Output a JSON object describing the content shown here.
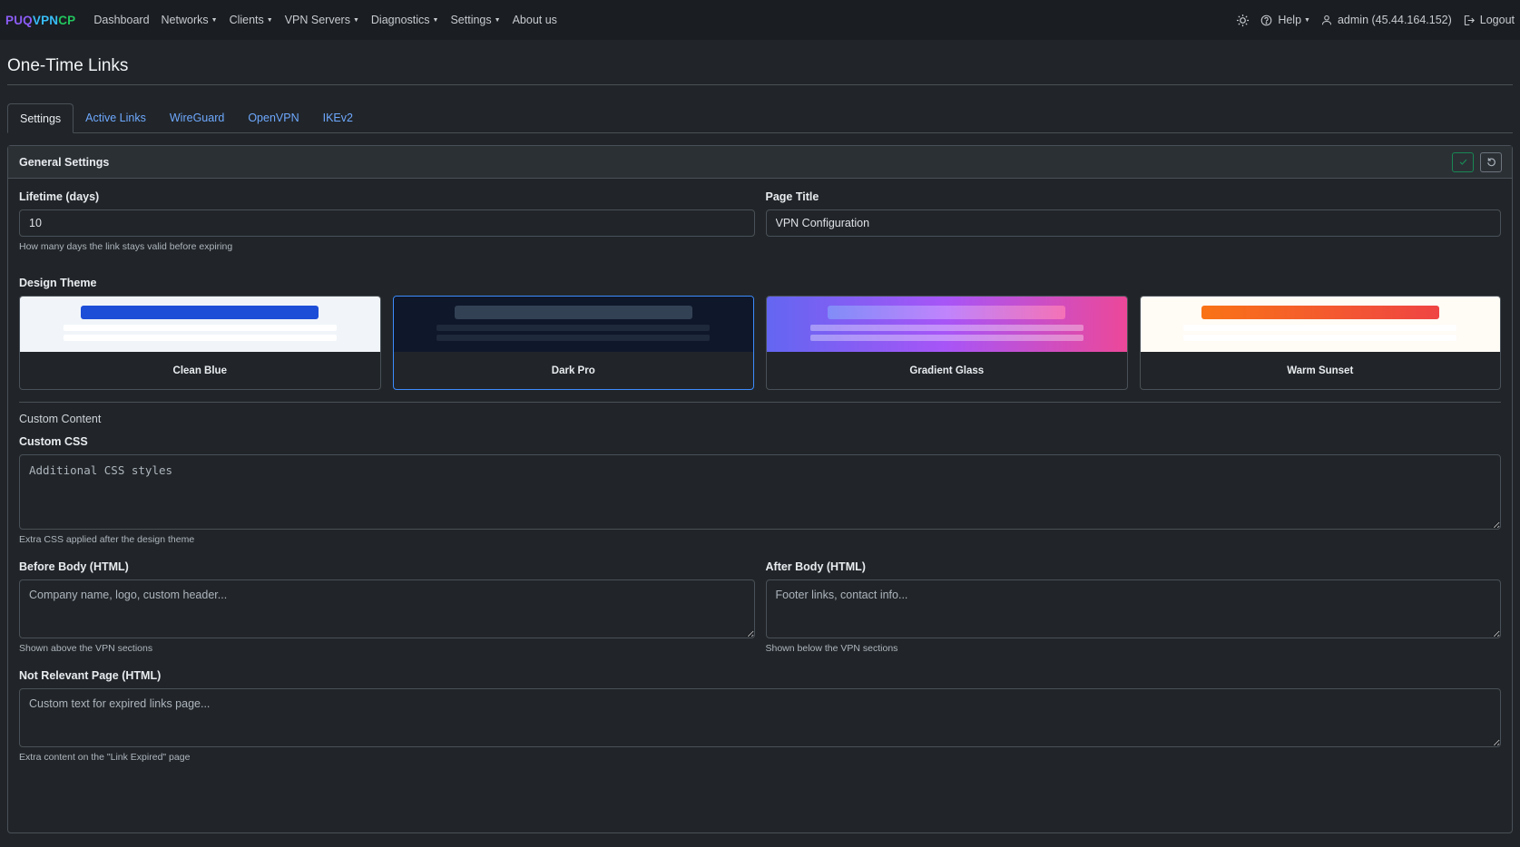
{
  "navbar": {
    "brand": {
      "part1": "PUQ",
      "part2": "VPN",
      "part3": "CP"
    },
    "items": [
      {
        "label": "Dashboard",
        "dropdown": false
      },
      {
        "label": "Networks",
        "dropdown": true
      },
      {
        "label": "Clients",
        "dropdown": true
      },
      {
        "label": "VPN Servers",
        "dropdown": true
      },
      {
        "label": "Diagnostics",
        "dropdown": true
      },
      {
        "label": "Settings",
        "dropdown": true
      },
      {
        "label": "About us",
        "dropdown": false
      }
    ],
    "right": {
      "theme_icon": "sun-icon",
      "help_label": "Help",
      "user_label": "admin (45.44.164.152)",
      "logout_label": "Logout"
    }
  },
  "page": {
    "title": "One-Time Links"
  },
  "tabs": [
    {
      "label": "Settings",
      "active": true
    },
    {
      "label": "Active Links",
      "active": false
    },
    {
      "label": "WireGuard",
      "active": false
    },
    {
      "label": "OpenVPN",
      "active": false
    },
    {
      "label": "IKEv2",
      "active": false
    }
  ],
  "card": {
    "title": "General Settings",
    "lifetime": {
      "label": "Lifetime (days)",
      "value": "10",
      "help": "How many days the link stays valid before expiring"
    },
    "page_title": {
      "label": "Page Title",
      "value": "VPN Configuration"
    },
    "design_theme": {
      "label": "Design Theme",
      "themes": [
        {
          "name": "Clean Blue",
          "selected": false,
          "bg": "#f1f5f9",
          "bar": "#1d4ed8",
          "line": "#ffffff"
        },
        {
          "name": "Dark Pro",
          "selected": true,
          "bg": "#0f172a",
          "bar": "#334155",
          "line": "#1e293b"
        },
        {
          "name": "Gradient Glass",
          "selected": false,
          "bg": "linear-gradient(90deg,#6366f1,#a855f7,#ec4899)",
          "bar": "linear-gradient(90deg,#818cf8,#c084fc,#f472b6)",
          "line": "rgba(255,255,255,0.35)"
        },
        {
          "name": "Warm Sunset",
          "selected": false,
          "bg": "#fffbf5",
          "bar": "linear-gradient(90deg,#f97316,#ef4444)",
          "line": "#ffffff"
        }
      ]
    },
    "custom_content": {
      "section_label": "Custom Content",
      "custom_css": {
        "label": "Custom CSS",
        "placeholder": "Additional CSS styles",
        "help": "Extra CSS applied after the design theme"
      },
      "before_body": {
        "label": "Before Body (HTML)",
        "placeholder": "Company name, logo, custom header...",
        "help": "Shown above the VPN sections"
      },
      "after_body": {
        "label": "After Body (HTML)",
        "placeholder": "Footer links, contact info...",
        "help": "Shown below the VPN sections"
      },
      "not_relevant": {
        "label": "Not Relevant Page (HTML)",
        "placeholder": "Custom text for expired links page...",
        "help": "Extra content on the \"Link Expired\" page"
      }
    }
  },
  "colors": {
    "accent": "#6ea8fe",
    "success": "#198754",
    "background": "#212529",
    "navbar": "#1a1d21"
  }
}
